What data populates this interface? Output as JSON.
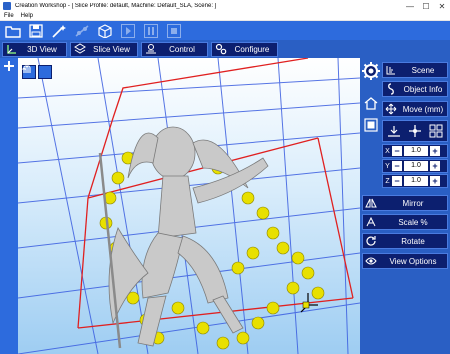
{
  "window": {
    "title": "Creation Workshop - [ Slice Profile: default, Machine: Default_SLA, Scene: ]",
    "minimize_glyph": "—",
    "maximize_glyph": "☐",
    "close_glyph": "✕"
  },
  "menu": {
    "items": [
      "File",
      "Help"
    ]
  },
  "toolbar": {
    "buttons": [
      {
        "icon": "open-folder-icon",
        "enabled": true
      },
      {
        "icon": "save-icon",
        "enabled": true
      },
      {
        "icon": "wand-icon",
        "enabled": true
      },
      {
        "icon": "connect-icon",
        "enabled": false
      },
      {
        "icon": "view-3d-box-icon",
        "enabled": true
      },
      {
        "icon": "play-icon",
        "enabled": false
      },
      {
        "icon": "pause-icon",
        "enabled": false
      },
      {
        "icon": "stop-icon",
        "enabled": false
      }
    ]
  },
  "tabs": [
    {
      "label": "3D View",
      "icon": "3d-view-icon"
    },
    {
      "label": "Slice View",
      "icon": "slice-view-icon"
    },
    {
      "label": "Control",
      "icon": "control-icon"
    },
    {
      "label": "Configure",
      "icon": "configure-icon"
    }
  ],
  "right_panel": {
    "scene_label": "Scene",
    "object_info_label": "Object Info",
    "move_label": "Move (mm)",
    "axes": [
      {
        "axis": "X",
        "value": "1.0"
      },
      {
        "axis": "Y",
        "value": "1.0"
      },
      {
        "axis": "Z",
        "value": "1.0"
      }
    ],
    "minus_glyph": "−",
    "plus_glyph": "+",
    "mirror_label": "Mirror",
    "scale_label": "Scale %",
    "rotate_label": "Rotate",
    "view_options_label": "View Options"
  },
  "colors": {
    "toolbar_blue": "#2d6bdd",
    "button_navy": "#0c1f6f",
    "grid_blue": "#3a5de0",
    "build_volume_red": "#e02020",
    "support_yellow": "#e8e000"
  }
}
